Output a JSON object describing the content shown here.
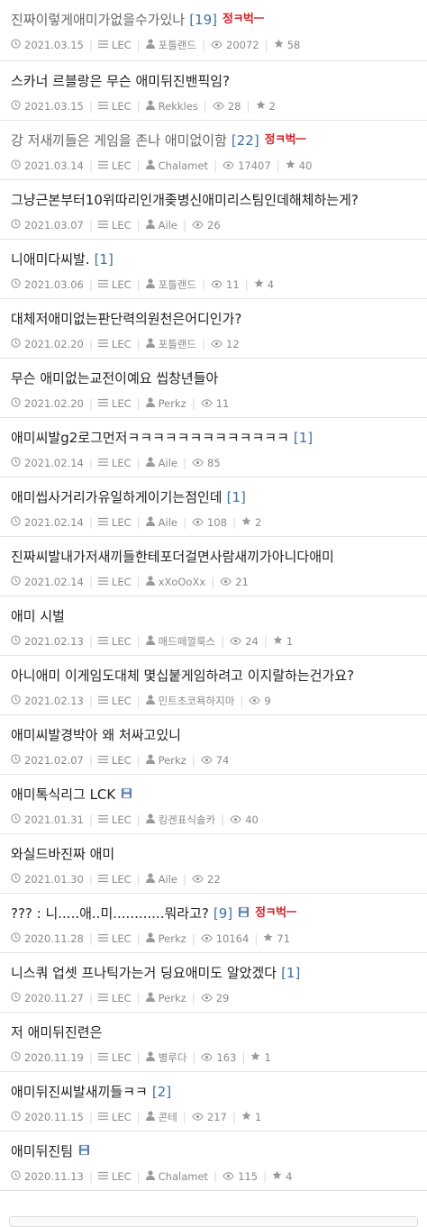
{
  "posts": [
    {
      "title": "진짜이렇게애미가없을수가있나",
      "comments": "[19]",
      "badge": "정ㅋ벅ㅡ",
      "date": "2021.03.15",
      "league": "LEC",
      "author": "포틀랜드",
      "views": "20072",
      "likes": "58",
      "best": true,
      "save": false
    },
    {
      "title": "스카너 르블랑은 무슨 애미뒤진밴픽임?",
      "comments": "",
      "badge": "",
      "date": "2021.03.15",
      "league": "LEC",
      "author": "Rekkles",
      "views": "28",
      "likes": "2",
      "best": false,
      "save": false
    },
    {
      "title": "강 저새끼들은 게임을 존나 애미없이함",
      "comments": "[22]",
      "badge": "정ㅋ벅ㅡ",
      "date": "2021.03.14",
      "league": "LEC",
      "author": "Chalamet",
      "views": "17407",
      "likes": "40",
      "best": true,
      "save": false
    },
    {
      "title": "그냥근본부터10위따리인개좆병신애미리스팀인데해체하는게?",
      "comments": "",
      "badge": "",
      "date": "2021.03.07",
      "league": "LEC",
      "author": "Aile",
      "views": "26",
      "likes": "",
      "best": false,
      "save": false
    },
    {
      "title": "니애미다씨발.",
      "comments": "[1]",
      "badge": "",
      "date": "2021.03.06",
      "league": "LEC",
      "author": "포틀랜드",
      "views": "11",
      "likes": "4",
      "best": false,
      "save": false
    },
    {
      "title": "대체저애미없는판단력의원천은어디인가?",
      "comments": "",
      "badge": "",
      "date": "2021.02.20",
      "league": "LEC",
      "author": "포틀랜드",
      "views": "12",
      "likes": "",
      "best": false,
      "save": false
    },
    {
      "title": "무슨 애미없는교전이예요 씹창년들아",
      "comments": "",
      "badge": "",
      "date": "2021.02.20",
      "league": "LEC",
      "author": "Perkz",
      "views": "11",
      "likes": "",
      "best": false,
      "save": false
    },
    {
      "title": "애미씨발g2로그먼저ㅋㅋㅋㅋㅋㅋㅋㅋㅋㅋㅋㅋㅋ",
      "comments": "[1]",
      "badge": "",
      "date": "2021.02.14",
      "league": "LEC",
      "author": "Aile",
      "views": "85",
      "likes": "",
      "best": false,
      "save": false
    },
    {
      "title": "애미씹사거리가유일하게이기는점인데",
      "comments": "[1]",
      "badge": "",
      "date": "2021.02.14",
      "league": "LEC",
      "author": "Aile",
      "views": "108",
      "likes": "2",
      "best": false,
      "save": false
    },
    {
      "title": "진짜씨발내가저새끼들한테포더걸면사람새끼가아니다애미",
      "comments": "",
      "badge": "",
      "date": "2021.02.14",
      "league": "LEC",
      "author": "xXoOoXx",
      "views": "21",
      "likes": "",
      "best": false,
      "save": false
    },
    {
      "title": "애미 시벌",
      "comments": "",
      "badge": "",
      "date": "2021.02.13",
      "league": "LEC",
      "author": "매드떼껄룩스",
      "views": "24",
      "likes": "1",
      "best": false,
      "save": false
    },
    {
      "title": "아니애미 이게임도대체 몇십붙게임하려고 이지랄하는건가요?",
      "comments": "",
      "badge": "",
      "date": "2021.02.13",
      "league": "LEC",
      "author": "민트초코욕하지마",
      "views": "9",
      "likes": "",
      "best": false,
      "save": false
    },
    {
      "title": "애미씨발경박아 왜 처싸고있니",
      "comments": "",
      "badge": "",
      "date": "2021.02.07",
      "league": "LEC",
      "author": "Perkz",
      "views": "74",
      "likes": "",
      "best": false,
      "save": false
    },
    {
      "title": "애미톡식리그 LCK",
      "comments": "",
      "badge": "",
      "date": "2021.01.31",
      "league": "LEC",
      "author": "킹겐표식솔카",
      "views": "40",
      "likes": "",
      "best": false,
      "save": true
    },
    {
      "title": "와실드바진짜 애미",
      "comments": "",
      "badge": "",
      "date": "2021.01.30",
      "league": "LEC",
      "author": "Aile",
      "views": "22",
      "likes": "",
      "best": false,
      "save": false
    },
    {
      "title": "??? : 니.....애..미............뭐라고?",
      "comments": "[9]",
      "badge": "정ㅋ벅ㅡ",
      "date": "2020.11.28",
      "league": "LEC",
      "author": "Perkz",
      "views": "10164",
      "likes": "71",
      "best": false,
      "save": true
    },
    {
      "title": "니스쿼 업셋 프나틱가는거 딩요애미도 알았겠다",
      "comments": "[1]",
      "badge": "",
      "date": "2020.11.27",
      "league": "LEC",
      "author": "Perkz",
      "views": "29",
      "likes": "",
      "best": false,
      "save": false
    },
    {
      "title": "저 애미뒤진련은",
      "comments": "",
      "badge": "",
      "date": "2020.11.19",
      "league": "LEC",
      "author": "별루다",
      "views": "163",
      "likes": "1",
      "best": false,
      "save": false
    },
    {
      "title": "애미뒤진씨발새끼들ㅋㅋ",
      "comments": "[2]",
      "badge": "",
      "date": "2020.11.15",
      "league": "LEC",
      "author": "콘테",
      "views": "217",
      "likes": "1",
      "best": false,
      "save": false
    },
    {
      "title": "애미뒤진팀",
      "comments": "",
      "badge": "",
      "date": "2020.11.13",
      "league": "LEC",
      "author": "Chalamet",
      "views": "115",
      "likes": "4",
      "best": false,
      "save": true
    }
  ],
  "icons": {
    "date": "clock-icon",
    "league": "list-icon",
    "author": "user-icon",
    "views": "eye-icon",
    "likes": "star-icon",
    "save": "floppy-disk-icon"
  },
  "colors": {
    "comment_count": "#3f6ea8",
    "badge": "#d2232a",
    "meta": "#8a8a8a",
    "best_title": "#666666"
  }
}
